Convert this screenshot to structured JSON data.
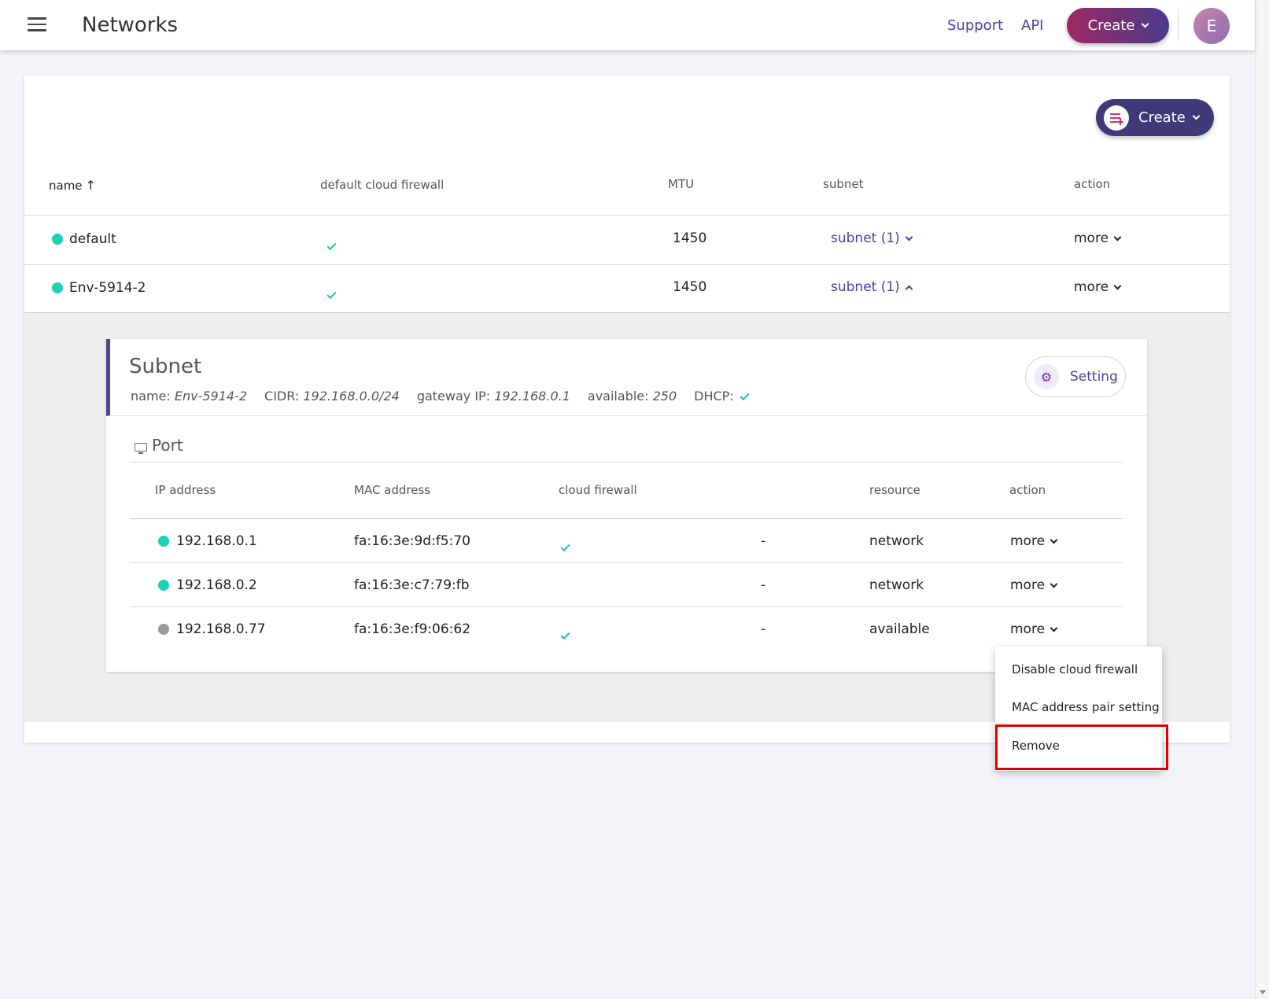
{
  "header": {
    "title": "Networks",
    "links": {
      "support": "Support",
      "api": "API"
    },
    "create_label": "Create",
    "avatar_initial": "E"
  },
  "toolbar": {
    "create_label": "Create"
  },
  "table": {
    "columns": {
      "name": "name",
      "firewall": "default cloud firewall",
      "mtu": "MTU",
      "subnet": "subnet",
      "action": "action"
    },
    "rows": [
      {
        "name": "default",
        "mtu": "1450",
        "subnet": "subnet (1)",
        "action": "more",
        "status": "active",
        "firewall": true,
        "expanded": false
      },
      {
        "name": "Env-5914-2",
        "mtu": "1450",
        "subnet": "subnet (1)",
        "action": "more",
        "status": "active",
        "firewall": true,
        "expanded": true
      }
    ]
  },
  "subnet": {
    "title": "Subnet",
    "name_label": "name:",
    "name": "Env-5914-2",
    "cidr_label": "CIDR:",
    "cidr": "192.168.0.0/24",
    "gateway_label": "gateway IP:",
    "gateway": "192.168.0.1",
    "available_label": "available:",
    "available": "250",
    "dhcp_label": "DHCP:",
    "dhcp": true,
    "setting_label": "Setting"
  },
  "ports": {
    "title": "Port",
    "columns": {
      "ip": "IP address",
      "mac": "MAC address",
      "firewall": "cloud firewall",
      "resource": "resource",
      "action": "action"
    },
    "rows": [
      {
        "ip": "192.168.0.1",
        "mac": "fa:16:3e:9d:f5:70",
        "firewall": true,
        "extra": "-",
        "resource": "network",
        "resource_link": true,
        "action": "more",
        "status": "active"
      },
      {
        "ip": "192.168.0.2",
        "mac": "fa:16:3e:c7:79:fb",
        "firewall": false,
        "extra": "-",
        "resource": "network",
        "resource_link": false,
        "action": "more",
        "status": "active"
      },
      {
        "ip": "192.168.0.77",
        "mac": "fa:16:3e:f9:06:62",
        "firewall": true,
        "extra": "-",
        "resource": "available",
        "resource_link": false,
        "action": "more",
        "status": "inactive"
      }
    ]
  },
  "menu": {
    "items": [
      "Disable cloud firewall",
      "MAC address pair setting",
      "Remove"
    ]
  },
  "colors": {
    "accent": "#4b3fa0",
    "status_active": "#19d3b2",
    "status_inactive": "#9a9a9a",
    "highlight": "#e00000"
  }
}
